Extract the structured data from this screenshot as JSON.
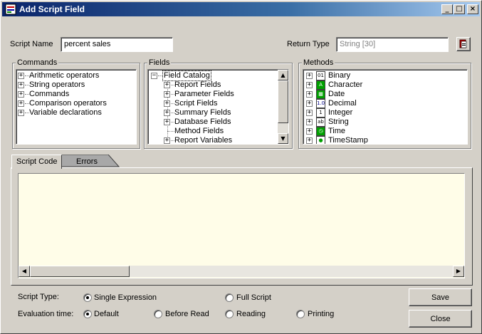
{
  "window": {
    "title": "Add Script Field",
    "minimize_glyph": "_",
    "maximize_glyph": "□",
    "close_glyph": "×"
  },
  "script_name": {
    "label": "Script Name",
    "value": "percent sales"
  },
  "return_type": {
    "label": "Return Type",
    "value": "String [30]",
    "picker_icon": "return-type-picker-icon"
  },
  "commands": {
    "label": "Commands",
    "items": [
      "Arithmetic operators",
      "String operators",
      "Commands",
      "Comparison operators",
      "Variable declarations"
    ]
  },
  "fields": {
    "label": "Fields",
    "root": "Field Catalog",
    "items": [
      "Report Fields",
      "Parameter Fields",
      "Script Fields",
      "Summary Fields",
      "Database Fields",
      "Method Fields",
      "Report Variables"
    ]
  },
  "methods": {
    "label": "Methods",
    "items": [
      "Binary",
      "Character",
      "Date",
      "Decimal",
      "Integer",
      "String",
      "Time",
      "TimeStamp"
    ],
    "icons": [
      "binary-icon",
      "character-icon",
      "date-icon",
      "decimal-icon",
      "integer-icon",
      "string-icon",
      "time-icon",
      "timestamp-icon"
    ],
    "glyphs": [
      "01",
      "A",
      "▦",
      "1.0",
      "1",
      "ab",
      "◷",
      "●"
    ]
  },
  "tabs": {
    "script_code": "Script Code",
    "errors": "Errors"
  },
  "script_code_value": "",
  "script_type": {
    "label": "Script Type:",
    "options": [
      "Single Expression",
      "Full Script"
    ],
    "selected": "Single Expression"
  },
  "evaluation_time": {
    "label": "Evaluation time:",
    "options": [
      "Default",
      "Before Read",
      "Reading",
      "Printing"
    ],
    "selected": "Default"
  },
  "buttons": {
    "save": "Save",
    "close": "Close"
  },
  "colors": {
    "titlebar_start": "#0a246a",
    "titlebar_end": "#a6caf0",
    "dialog_face": "#d4d0c8",
    "code_area": "#fffde8"
  }
}
